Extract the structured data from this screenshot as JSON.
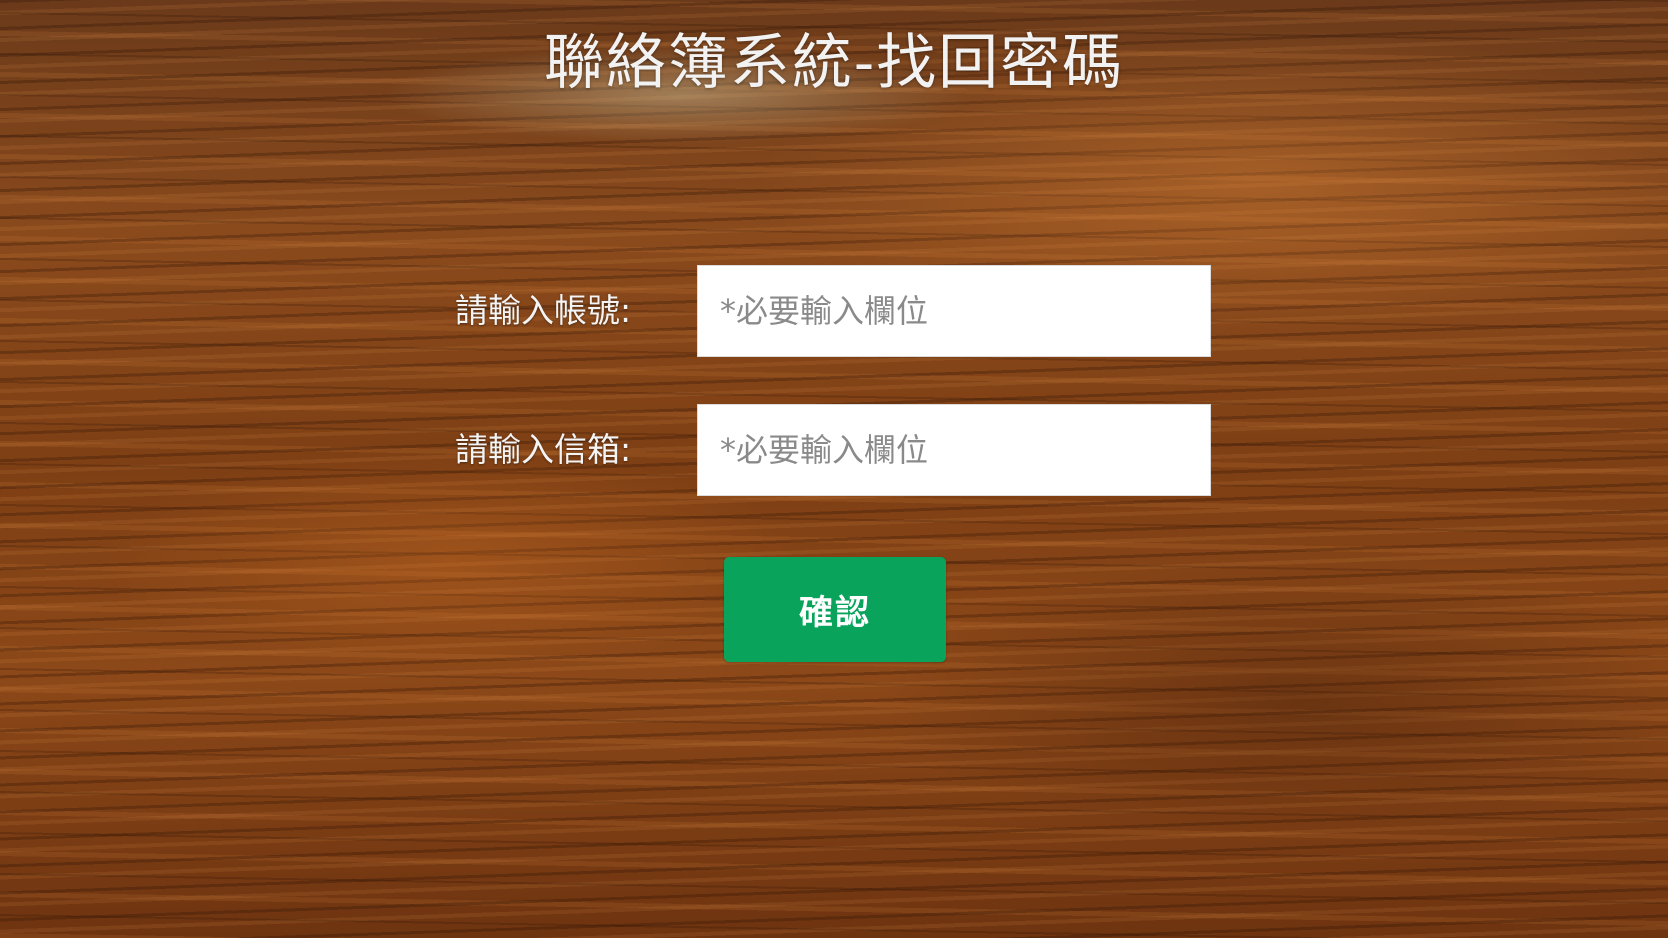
{
  "page": {
    "title": "聯絡簿系統-找回密碼"
  },
  "form": {
    "account": {
      "label": "請輸入帳號:",
      "placeholder": "*必要輸入欄位",
      "value": ""
    },
    "email": {
      "label": "請輸入信箱:",
      "placeholder": "*必要輸入欄位",
      "value": ""
    },
    "confirm_label": "確認"
  },
  "colors": {
    "button": "#0aa35c",
    "title_text": "#f2f2f2",
    "input_background": "#ffffff",
    "placeholder": "#8a8a8a"
  }
}
